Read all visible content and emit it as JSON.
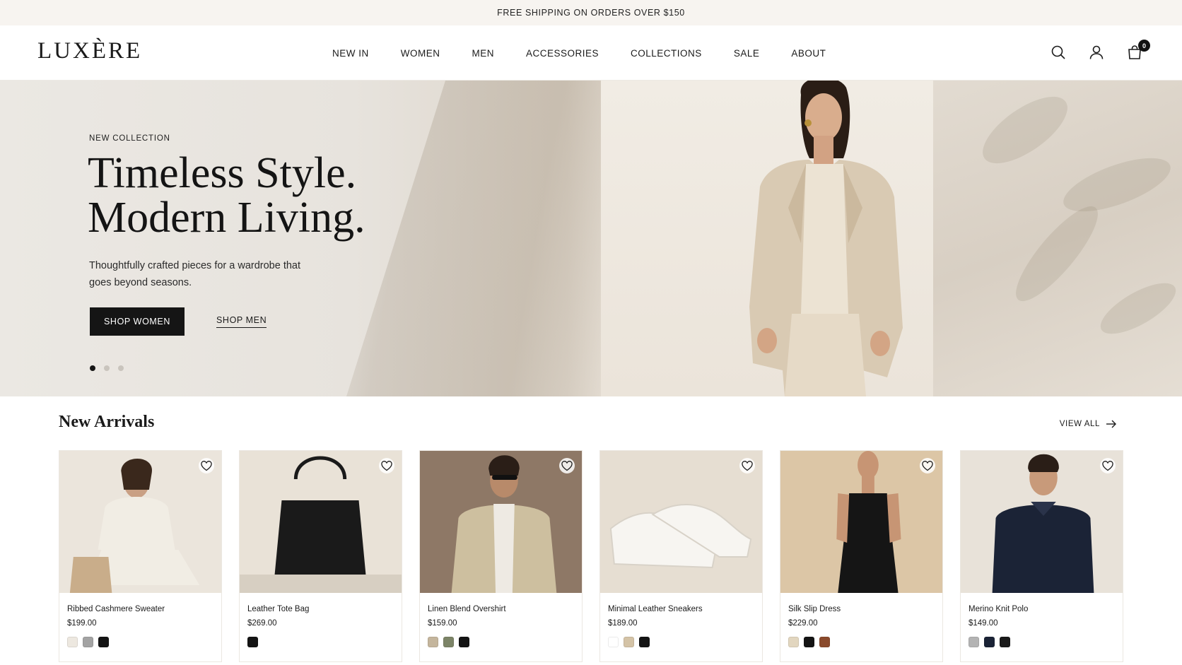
{
  "announcement": "FREE SHIPPING ON ORDERS OVER $150",
  "brand": "LUXÈRE",
  "nav": [
    "NEW IN",
    "WOMEN",
    "MEN",
    "ACCESSORIES",
    "COLLECTIONS",
    "SALE",
    "ABOUT"
  ],
  "header_icons": [
    "search-icon",
    "user-icon",
    "bag-icon"
  ],
  "cart_count": "0",
  "hero": {
    "eyebrow": "NEW COLLECTION",
    "title_line1": "Timeless Style.",
    "title_line2": "Modern Living.",
    "subtitle": "Thoughtfully crafted pieces for a wardrobe that goes beyond seasons.",
    "primary_cta": "SHOP WOMEN",
    "secondary_cta": "SHOP MEN",
    "slide_count": 3,
    "active_slide": 1
  },
  "arrivals": {
    "title": "New Arrivals",
    "view_all": "VIEW ALL",
    "products": [
      {
        "name": "Ribbed Cashmere Sweater",
        "price": "$199.00",
        "swatches": [
          "#ede8e0",
          "#a3a3a3",
          "#141414"
        ],
        "bg": "#ebe5dc",
        "subject": "#f1ede4"
      },
      {
        "name": "Leather Tote Bag",
        "price": "$269.00",
        "swatches": [
          "#141414"
        ],
        "bg": "#e9e2d7",
        "subject": "#1a1a1a"
      },
      {
        "name": "Linen Blend Overshirt",
        "price": "$159.00",
        "swatches": [
          "#c4b59c",
          "#7c8467",
          "#141414"
        ],
        "bg": "#8e7866",
        "subject": "#cdbf9f"
      },
      {
        "name": "Minimal Leather Sneakers",
        "price": "$189.00",
        "swatches": [
          "#ffffff",
          "#d4c3a6",
          "#141414"
        ],
        "bg": "#e6ded2",
        "subject": "#f7f5f1"
      },
      {
        "name": "Silk Slip Dress",
        "price": "$229.00",
        "swatches": [
          "#e2d6bf",
          "#141414",
          "#8a4a2c"
        ],
        "bg": "#dcc6a6",
        "subject": "#151515"
      },
      {
        "name": "Merino Knit Polo",
        "price": "$149.00",
        "swatches": [
          "#b3b3b3",
          "#1b2336",
          "#1a1a1a"
        ],
        "bg": "#e8e2d9",
        "subject": "#1b2336"
      }
    ]
  }
}
